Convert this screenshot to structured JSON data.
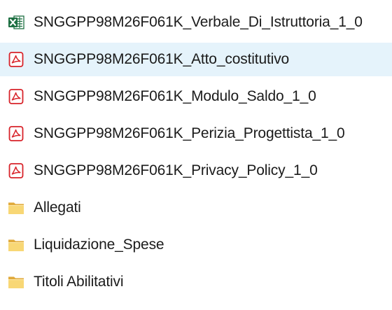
{
  "explorer": {
    "items": [
      {
        "name": "SNGGPP98M26F061K_Verbale_Di_Istruttoria_1_0",
        "type": "excel",
        "icon": "excel-file-icon",
        "selected": false
      },
      {
        "name": "SNGGPP98M26F061K_Atto_costitutivo",
        "type": "pdf",
        "icon": "pdf-file-icon",
        "selected": true
      },
      {
        "name": "SNGGPP98M26F061K_Modulo_Saldo_1_0",
        "type": "pdf",
        "icon": "pdf-file-icon",
        "selected": false
      },
      {
        "name": "SNGGPP98M26F061K_Perizia_Progettista_1_0",
        "type": "pdf",
        "icon": "pdf-file-icon",
        "selected": false
      },
      {
        "name": "SNGGPP98M26F061K_Privacy_Policy_1_0",
        "type": "pdf",
        "icon": "pdf-file-icon",
        "selected": false
      },
      {
        "name": "Allegati",
        "type": "folder",
        "icon": "folder-icon",
        "selected": false
      },
      {
        "name": "Liquidazione_Spese",
        "type": "folder",
        "icon": "folder-icon",
        "selected": false
      },
      {
        "name": "Titoli Abilitativi",
        "type": "folder",
        "icon": "folder-icon",
        "selected": false
      }
    ]
  },
  "colors": {
    "selection_background": "#e5f3fb",
    "text": "#1b1b1b",
    "pdf_red": "#d8232a",
    "excel_green": "#1d6f42",
    "folder_yellow": "#f8d775"
  }
}
